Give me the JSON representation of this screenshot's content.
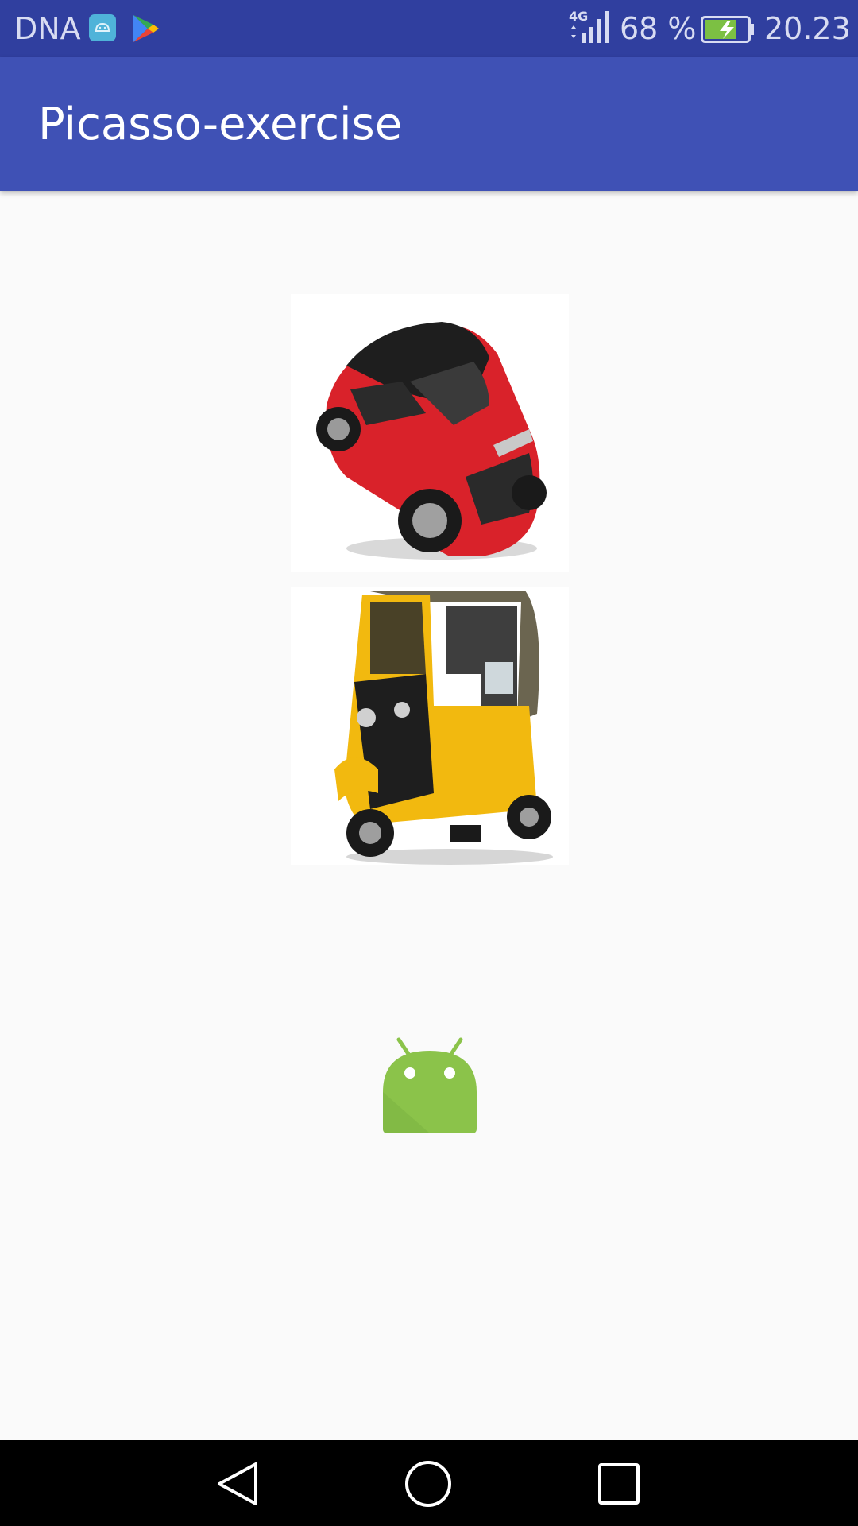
{
  "status_bar": {
    "carrier": "DNA",
    "network_type": "4G",
    "battery_percent": "68 %",
    "time": "20.23",
    "icons": [
      "android-notification-icon",
      "play-store-icon",
      "signal-icon",
      "battery-charging-icon"
    ]
  },
  "app_bar": {
    "title": "Picasso-exercise"
  },
  "content": {
    "images": [
      {
        "name": "red-car-image",
        "description_icon": "car"
      },
      {
        "name": "yellow-rickshaw-image",
        "description_icon": "auto-rickshaw"
      }
    ],
    "placeholder_icon": "android-robot-icon"
  },
  "nav_bar": {
    "buttons": [
      "back-icon",
      "home-icon",
      "recents-icon"
    ]
  },
  "colors": {
    "status_bar": "#303f9f",
    "app_bar": "#3f51b5",
    "background": "#fafafa",
    "android_green": "#8bc34a"
  }
}
